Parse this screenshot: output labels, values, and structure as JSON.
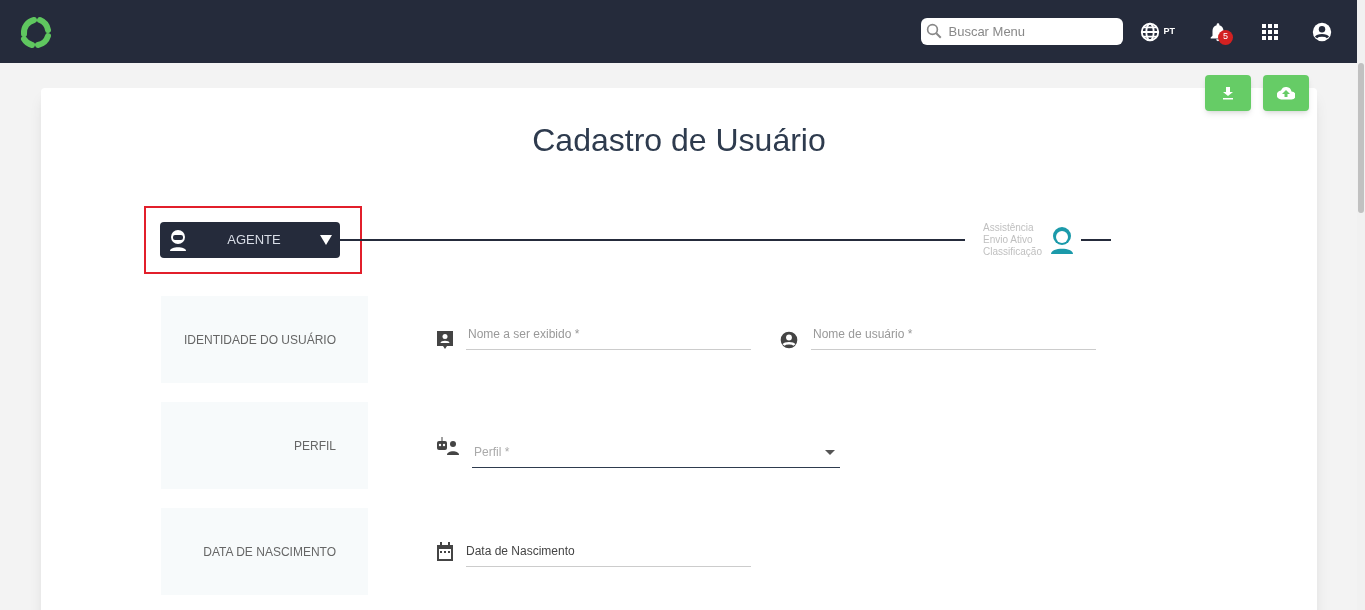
{
  "header": {
    "search": {
      "placeholder": "Buscar Menu"
    },
    "language": "PT",
    "notifications": "5"
  },
  "page": {
    "title": "Cadastro de Usuário"
  },
  "stepper": {
    "selector": "AGENTE",
    "steps": [
      "Assistência",
      "Envio Ativo",
      "Classificação"
    ]
  },
  "sections": [
    {
      "label": "IDENTIDADE DO USUÁRIO",
      "fields": [
        {
          "kind": "display-name",
          "placeholder": "Nome a ser exibido *"
        },
        {
          "kind": "username",
          "placeholder": "Nome de usuário *"
        }
      ]
    },
    {
      "label": "PERFIL",
      "fields": [
        {
          "kind": "select",
          "placeholder": "Perfil *"
        }
      ]
    },
    {
      "label": "DATA DE NASCIMENTO",
      "fields": [
        {
          "kind": "date",
          "placeholder": "Data de Nascimento"
        }
      ]
    }
  ]
}
